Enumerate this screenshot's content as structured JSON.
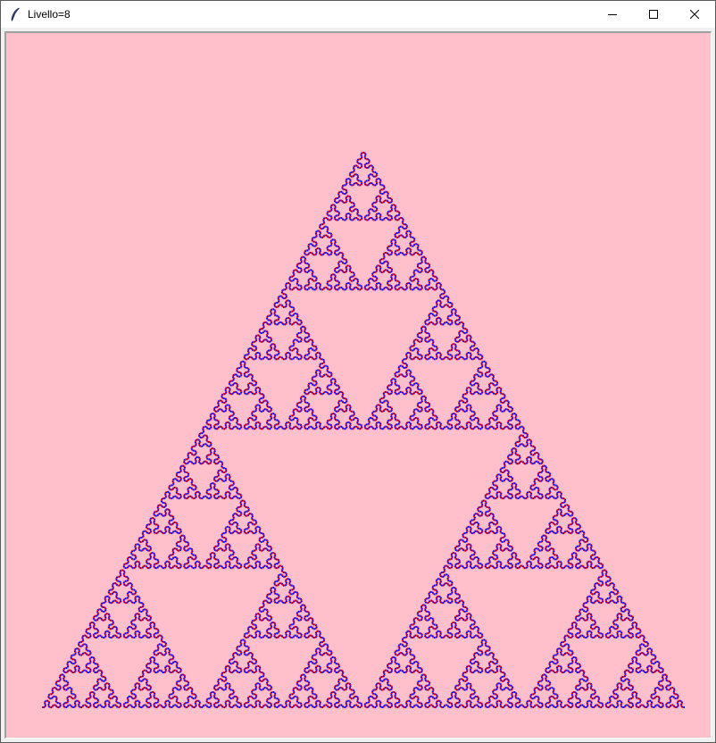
{
  "window": {
    "title": "Livello=8",
    "icon": "feather-icon",
    "buttons": [
      "minimize-icon",
      "maximize-icon",
      "close-icon"
    ]
  },
  "canvas": {
    "background": "#ffc0cb",
    "curve_level": 8,
    "colors": [
      "#ff0000",
      "#0000ff"
    ]
  }
}
